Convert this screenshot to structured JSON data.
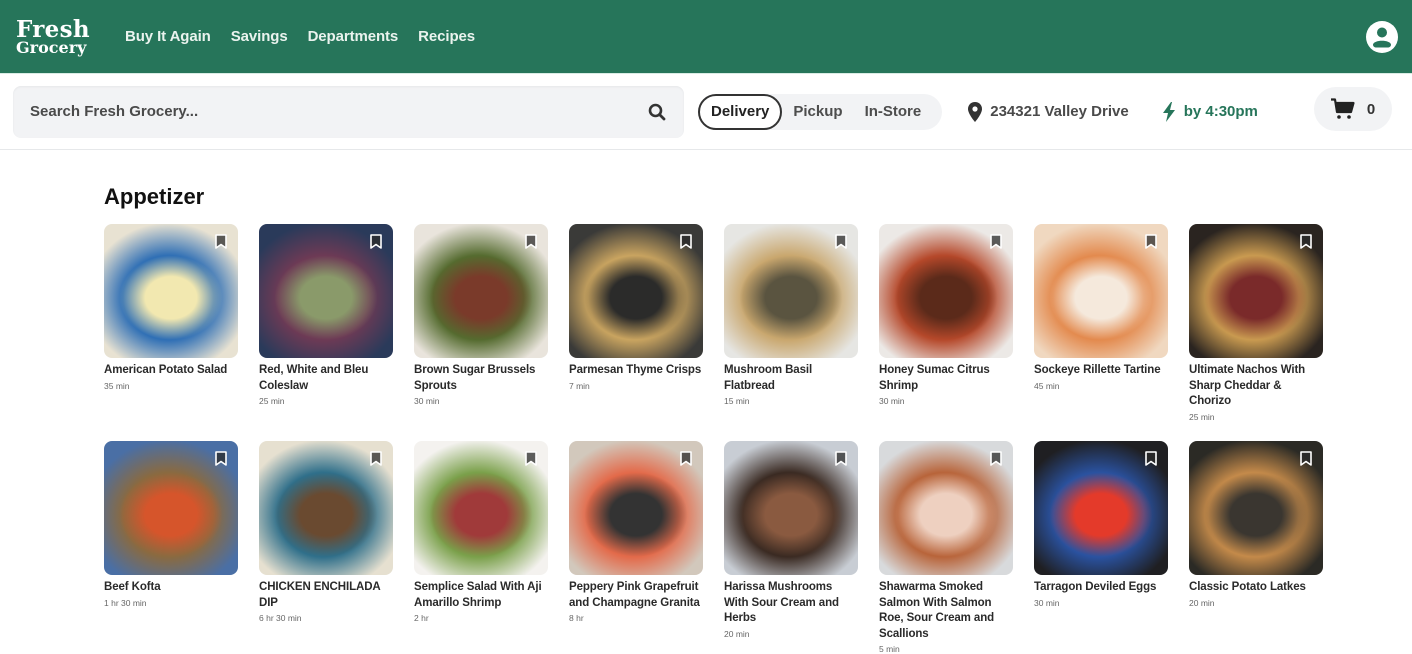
{
  "header": {
    "logo_line1": "Fresh",
    "logo_line2": "Grocery",
    "nav": [
      "Buy It Again",
      "Savings",
      "Departments",
      "Recipes"
    ],
    "account_icon": "account-circle-icon",
    "brand_color": "#26755a"
  },
  "subbar": {
    "search_placeholder": "Search Fresh Grocery...",
    "search_value": "",
    "modes": [
      "Delivery",
      "Pickup",
      "In-Store"
    ],
    "active_mode": "Delivery",
    "address": "234321 Valley Drive",
    "eta": "by 4:30pm",
    "cart_count": "0"
  },
  "section": {
    "title": "Appetizer",
    "recipes": [
      {
        "name": "American Potato Salad",
        "time": "35 min",
        "colors": [
          "#e8e2d2",
          "#2f6fb5",
          "#f2e8b0"
        ]
      },
      {
        "name": "Red, White and Bleu Coleslaw",
        "time": "25 min",
        "colors": [
          "#2a3a5a",
          "#6d3a55",
          "#8a9a6a"
        ]
      },
      {
        "name": "Brown Sugar Brussels Sprouts",
        "time": "30 min",
        "colors": [
          "#e9e4dc",
          "#556b2f",
          "#7a3a2a"
        ]
      },
      {
        "name": "Parmesan Thyme Crisps",
        "time": "7 min",
        "colors": [
          "#3a3a38",
          "#c9a460",
          "#2b2b2a"
        ]
      },
      {
        "name": "Mushroom Basil Flatbread",
        "time": "15 min",
        "colors": [
          "#e6e6e3",
          "#c9a76e",
          "#5a5440"
        ]
      },
      {
        "name": "Honey Sumac Citrus Shrimp",
        "time": "30 min",
        "colors": [
          "#ece9e6",
          "#b5482a",
          "#5b2a1a"
        ]
      },
      {
        "name": "Sockeye Rillette Tartine",
        "time": "45 min",
        "colors": [
          "#f0d8c0",
          "#e38a4e",
          "#f5e9dc"
        ]
      },
      {
        "name": "Ultimate Nachos With Sharp Cheddar & Chorizo",
        "time": "25 min",
        "colors": [
          "#2a2420",
          "#c99a50",
          "#7a2a2a"
        ]
      },
      {
        "name": "Beef Kofta",
        "time": "1 hr 30 min",
        "colors": [
          "#4a6fa5",
          "#8a6a40",
          "#d6552b"
        ]
      },
      {
        "name": "CHICKEN ENCHILADA DIP",
        "time": "6 hr 30 min",
        "colors": [
          "#e6e0d0",
          "#2f6f8a",
          "#6a4a30"
        ]
      },
      {
        "name": "Semplice Salad With Aji Amarillo Shrimp",
        "time": "2 hr",
        "colors": [
          "#f4f2ef",
          "#7aa04a",
          "#a03a3a"
        ]
      },
      {
        "name": "Peppery Pink Grapefruit and Champagne Granita",
        "time": "8 hr",
        "colors": [
          "#d2c8bc",
          "#e36a4a",
          "#333333"
        ]
      },
      {
        "name": "Harissa Mushrooms With Sour Cream and Herbs",
        "time": "20 min",
        "colors": [
          "#c8cdd4",
          "#3a2a22",
          "#8a5a40"
        ]
      },
      {
        "name": "Shawarma Smoked Salmon With Salmon Roe, Sour Cream and Scallions",
        "time": "5 min",
        "colors": [
          "#d8dadc",
          "#b8643a",
          "#eed0c0"
        ]
      },
      {
        "name": "Tarragon Deviled Eggs",
        "time": "30 min",
        "colors": [
          "#1f1f22",
          "#2a52a0",
          "#e43a2a"
        ]
      },
      {
        "name": "Classic Potato Latkes",
        "time": "20 min",
        "colors": [
          "#2b2a25",
          "#c48a4a",
          "#3a3630"
        ]
      }
    ]
  }
}
